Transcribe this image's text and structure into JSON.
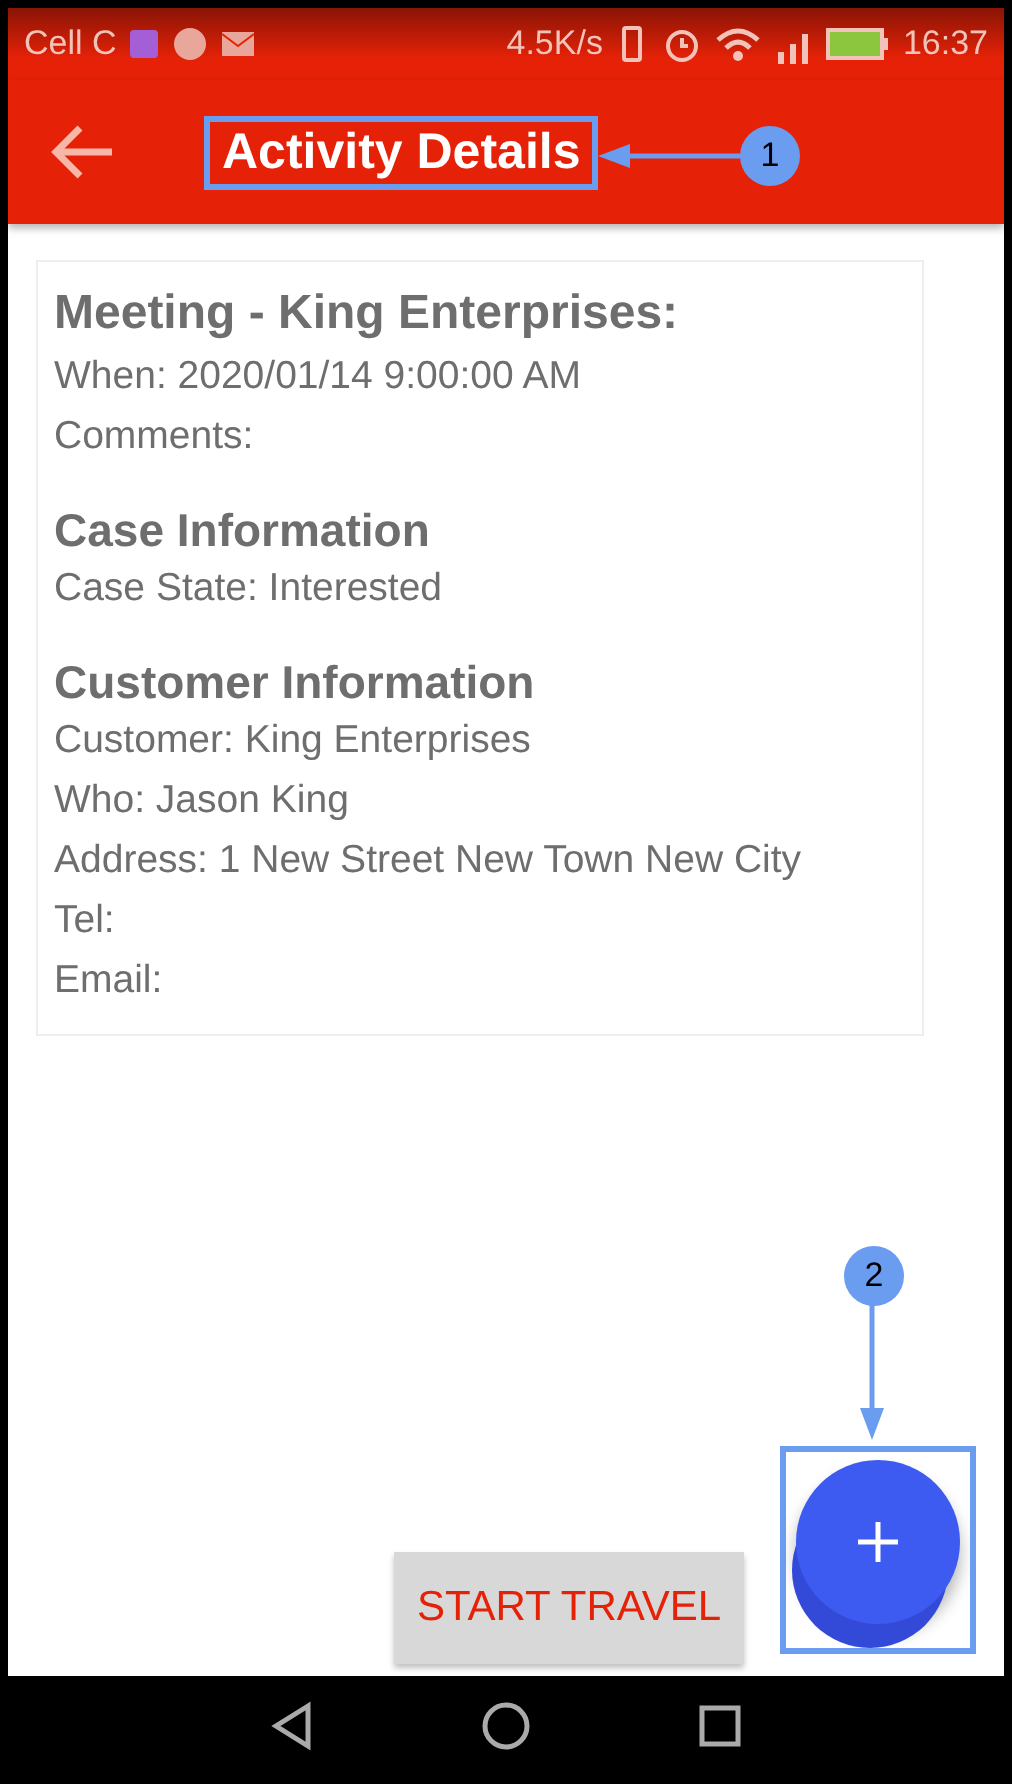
{
  "status_bar": {
    "carrier": "Cell C",
    "speed": "4.5K/s",
    "time": "16:37"
  },
  "app_bar": {
    "title": "Activity Details"
  },
  "details": [
    {
      "kind": "title",
      "text": "Meeting - King Enterprises:"
    },
    {
      "kind": "line",
      "text": "When: 2020/01/14 9:00:00 AM"
    },
    {
      "kind": "line",
      "text": "Comments:"
    },
    {
      "kind": "heading",
      "text": "Case Information"
    },
    {
      "kind": "line",
      "text": "Case State: Interested"
    },
    {
      "kind": "heading",
      "text": "Customer Information"
    },
    {
      "kind": "line",
      "text": "Customer: King Enterprises"
    },
    {
      "kind": "line",
      "text": "Who: Jason King"
    },
    {
      "kind": "line",
      "text": "Address: 1 New Street New Town New City"
    },
    {
      "kind": "line",
      "text": "Tel:"
    },
    {
      "kind": "line",
      "text": "Email:"
    }
  ],
  "start_button": {
    "label": "START TRAVEL"
  },
  "annotations": [
    {
      "label": "1"
    },
    {
      "label": "2"
    }
  ]
}
